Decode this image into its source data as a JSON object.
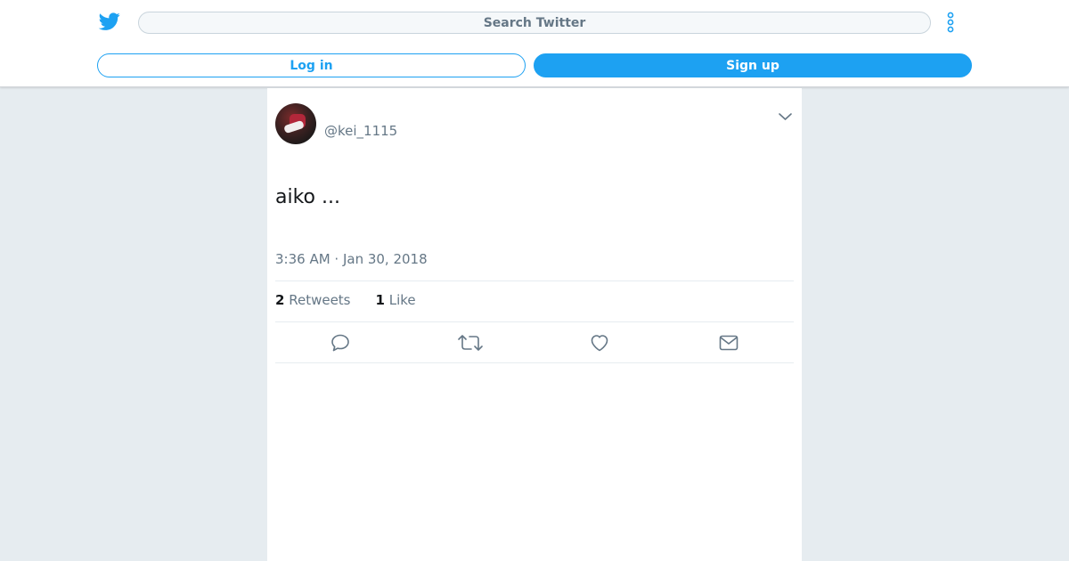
{
  "header": {
    "search_placeholder": "Search Twitter",
    "login_label": "Log in",
    "signup_label": "Sign up",
    "logo_icon": "twitter-bird-icon",
    "more_icon": "more-vertical-icon"
  },
  "tweet": {
    "handle": "@kei_1115",
    "text": "aiko ...",
    "timestamp": "3:36 AM · Jan 30, 2018",
    "retweet_count": "2",
    "retweet_label": "Retweets",
    "like_count": "1",
    "like_label": "Like"
  },
  "colors": {
    "brand": "#1da1f2",
    "background": "#e6ecf0",
    "secondary_text": "#657786"
  },
  "actions": [
    "reply-icon",
    "retweet-icon",
    "like-icon",
    "direct-message-icon"
  ]
}
